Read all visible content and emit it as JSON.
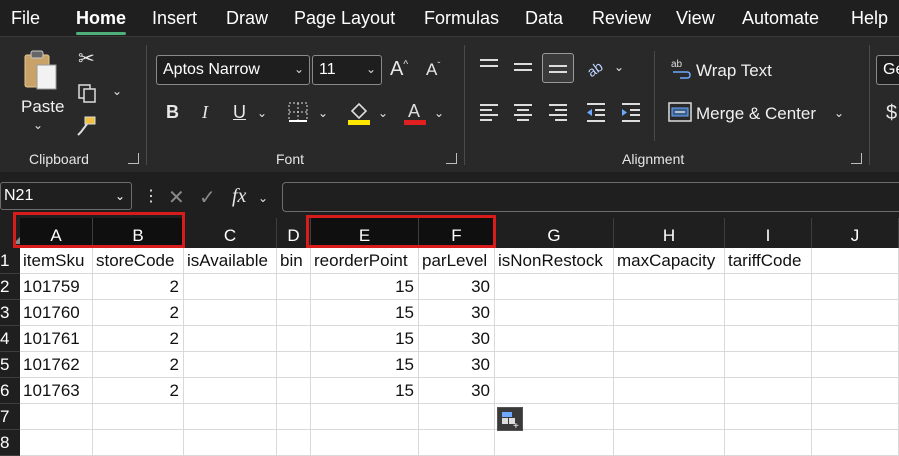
{
  "menu": [
    "File",
    "Home",
    "Insert",
    "Draw",
    "Page Layout",
    "Formulas",
    "Data",
    "Review",
    "View",
    "Automate",
    "Help"
  ],
  "ribbon": {
    "clipboard": {
      "paste_label": "Paste",
      "group_label": "Clipboard"
    },
    "font": {
      "font_name": "Aptos Narrow",
      "font_size": "11",
      "group_label": "Font",
      "fill_color": "#ffe600",
      "font_color": "#e02020"
    },
    "alignment": {
      "wrap_text": "Wrap Text",
      "merge_center": "Merge & Center",
      "group_label": "Alignment"
    },
    "number_format_partial": "Ge"
  },
  "formula_bar": {
    "name_box": "N21",
    "fx_label": "fx"
  },
  "columns": [
    "A",
    "B",
    "C",
    "D",
    "E",
    "F",
    "G",
    "H",
    "I",
    "J"
  ],
  "rows": [
    "1",
    "2",
    "3",
    "4",
    "5",
    "6",
    "7",
    "8"
  ],
  "sheet": {
    "headers": [
      "itemSku",
      "storeCode",
      "isAvailable",
      "bin",
      "reorderPoint",
      "parLevel",
      "isNonRestock",
      "maxCapacity",
      "tariffCode"
    ],
    "data": [
      [
        "101759",
        "2",
        "",
        "",
        "15",
        "30"
      ],
      [
        "101760",
        "2",
        "",
        "",
        "15",
        "30"
      ],
      [
        "101761",
        "2",
        "",
        "",
        "15",
        "30"
      ],
      [
        "101762",
        "2",
        "",
        "",
        "15",
        "30"
      ],
      [
        "101763",
        "2",
        "",
        "",
        "15",
        "30"
      ]
    ]
  },
  "highlight_color": "#d81b1b"
}
